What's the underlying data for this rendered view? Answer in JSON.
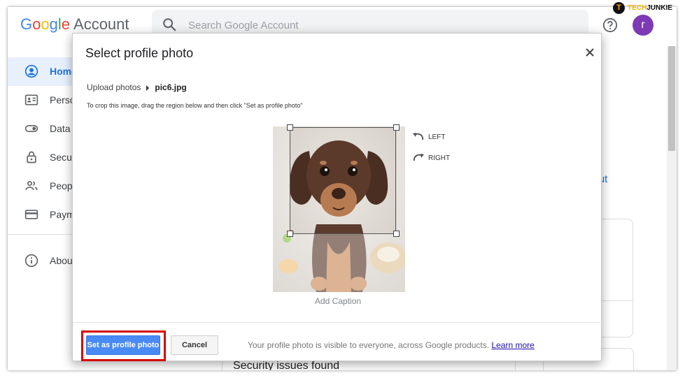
{
  "header": {
    "logo": {
      "google": "Google",
      "account": "Account"
    },
    "search_placeholder": "Search Google Account",
    "avatar_initial": "r"
  },
  "sidebar": {
    "items": [
      {
        "label": "Home",
        "icon": "account-circle-icon",
        "active": true
      },
      {
        "label": "Perso",
        "icon": "id-card-icon"
      },
      {
        "label": "Data",
        "icon": "toggle-icon"
      },
      {
        "label": "Secu",
        "icon": "lock-icon"
      },
      {
        "label": "Peop",
        "icon": "people-icon"
      },
      {
        "label": "Paym",
        "icon": "credit-card-icon"
      }
    ],
    "about": {
      "label": "Abou",
      "icon": "info-icon"
    }
  },
  "background": {
    "link_fragment": "l out",
    "security_text": "Security issues found"
  },
  "dialog": {
    "title": "Select profile photo",
    "breadcrumb": {
      "parent": "Upload photos",
      "file": "pic6.jpg"
    },
    "instruction": "To crop this image, drag the region below and then click \"Set as profile photo\"",
    "rotate_left": "LEFT",
    "rotate_right": "RIGHT",
    "caption_placeholder": "Add Caption",
    "set_button": "Set as profile photo",
    "cancel_button": "Cancel",
    "visibility_text": "Your profile photo is visible to everyone, across Google products.",
    "learn_more": "Learn more"
  },
  "watermark": {
    "logo_letter": "T",
    "part1": "TECH",
    "part2": "JUNKIE"
  },
  "colors": {
    "primary_button": "#4a8af4",
    "highlight_border": "#d60000",
    "link": "#1a73e8",
    "avatar": "#7e3ab5"
  }
}
